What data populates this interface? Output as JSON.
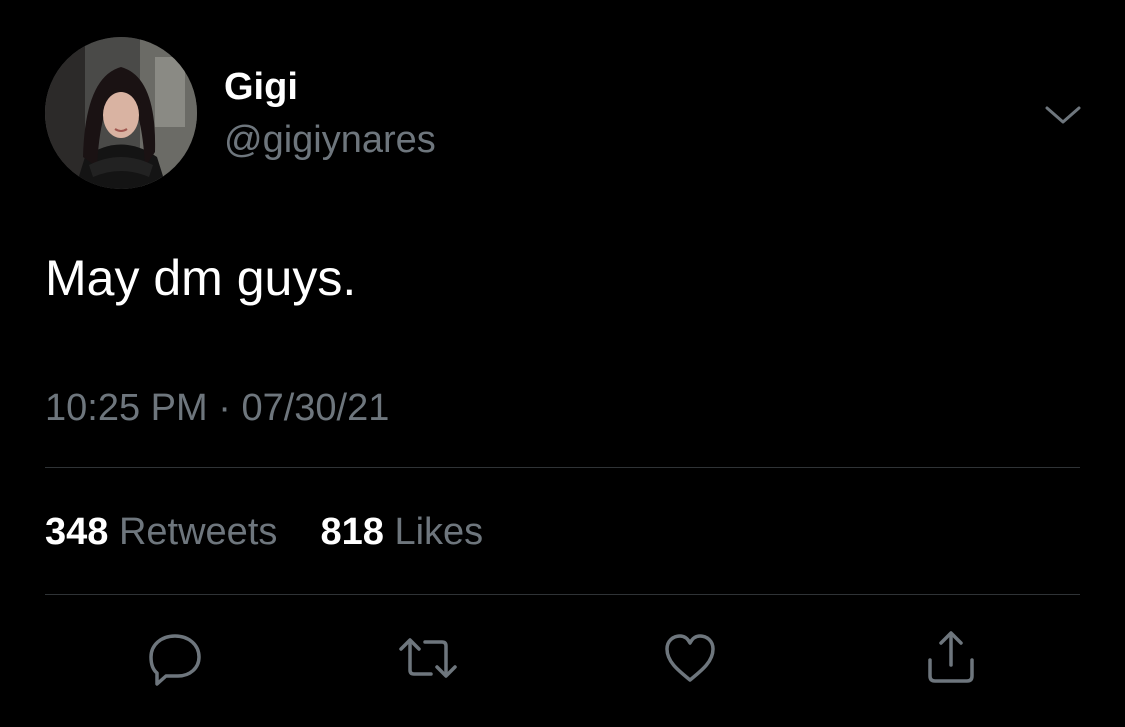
{
  "tweet": {
    "display_name": "Gigi",
    "handle": "@gigiynares",
    "text": "May dm guys.",
    "time": "10:25 PM",
    "separator": "·",
    "date": "07/30/21"
  },
  "stats": {
    "retweets_count": "348",
    "retweets_label": "Retweets",
    "likes_count": "818",
    "likes_label": "Likes"
  },
  "actions": {
    "reply_icon": "reply-icon",
    "retweet_icon": "retweet-icon",
    "like_icon": "heart-icon",
    "share_icon": "share-icon"
  },
  "colors": {
    "background": "#000000",
    "primary_text": "#ffffff",
    "secondary_text": "#6e767d",
    "divider": "#2f3336"
  }
}
